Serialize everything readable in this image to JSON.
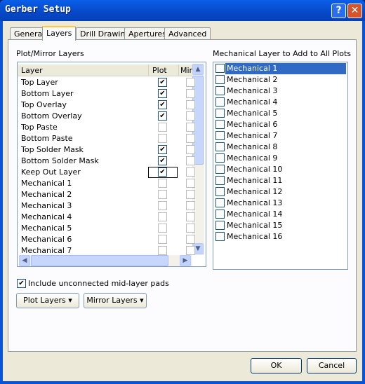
{
  "window": {
    "title": "Gerber Setup",
    "help_icon": "question-icon",
    "close_icon": "close-icon"
  },
  "tabs": [
    {
      "label": "General"
    },
    {
      "label": "Layers",
      "active": true
    },
    {
      "label": "Drill Drawing"
    },
    {
      "label": "Apertures"
    },
    {
      "label": "Advanced"
    }
  ],
  "plot_mirror": {
    "group_label": "Plot/Mirror Layers",
    "columns": [
      "Layer",
      "Plot",
      "Mirr"
    ],
    "rows": [
      {
        "layer": "Top Layer",
        "plot": true,
        "mirror": false
      },
      {
        "layer": "Bottom Layer",
        "plot": true,
        "mirror": false
      },
      {
        "layer": "Top Overlay",
        "plot": true,
        "mirror": false
      },
      {
        "layer": "Bottom Overlay",
        "plot": true,
        "mirror": false
      },
      {
        "layer": "Top Paste",
        "plot": false,
        "mirror": false
      },
      {
        "layer": "Bottom Paste",
        "plot": false,
        "mirror": false
      },
      {
        "layer": "Top Solder Mask",
        "plot": true,
        "mirror": false
      },
      {
        "layer": "Bottom Solder Mask",
        "plot": true,
        "mirror": false
      },
      {
        "layer": "Keep Out Layer",
        "plot": true,
        "mirror": false,
        "focused": true
      },
      {
        "layer": "Mechanical 1",
        "plot": false,
        "mirror": false
      },
      {
        "layer": "Mechanical 2",
        "plot": false,
        "mirror": false
      },
      {
        "layer": "Mechanical 3",
        "plot": false,
        "mirror": false
      },
      {
        "layer": "Mechanical 4",
        "plot": false,
        "mirror": false
      },
      {
        "layer": "Mechanical 5",
        "plot": false,
        "mirror": false
      },
      {
        "layer": "Mechanical 6",
        "plot": false,
        "mirror": false
      },
      {
        "layer": "Mechanical 7",
        "plot": false,
        "mirror": false
      }
    ]
  },
  "mechanical": {
    "group_label": "Mechanical Layer to Add to All Plots",
    "items": [
      "Mechanical 1",
      "Mechanical 2",
      "Mechanical 3",
      "Mechanical 4",
      "Mechanical 5",
      "Mechanical 6",
      "Mechanical 7",
      "Mechanical 8",
      "Mechanical 9",
      "Mechanical 10",
      "Mechanical 11",
      "Mechanical 12",
      "Mechanical 13",
      "Mechanical 14",
      "Mechanical 15",
      "Mechanical 16"
    ],
    "selected": "Mechanical 1"
  },
  "include_pads": {
    "label": "Include unconnected mid-layer pads",
    "checked": true
  },
  "buttons": {
    "plot_layers": "Plot Layers",
    "mirror_layers": "Mirror Layers",
    "ok": "OK",
    "cancel": "Cancel"
  },
  "colors": {
    "selection": "#316ac5",
    "titlebar": "#0a5fe8",
    "face": "#ece9d8"
  }
}
